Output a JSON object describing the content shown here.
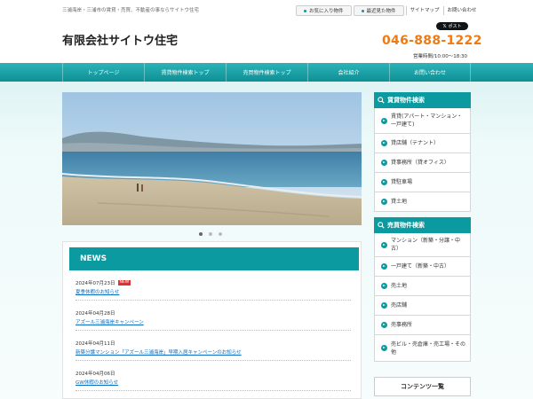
{
  "header": {
    "tagline": "三浦海岸・三浦市の賃貸・売買、不動産の事ならサイトウ住宅",
    "logo": "有限会社サイトウ住宅",
    "phone": "046-888-1222",
    "hours": "営業時間/10:00～18:30",
    "post_label": "ポスト",
    "top_links": {
      "favorites": "お気に入り物件",
      "recent": "最近見た物件",
      "sitemap": "サイトマップ",
      "contact": "お問い合わせ"
    }
  },
  "nav": {
    "items": [
      {
        "label": "トップページ"
      },
      {
        "label": "賃貸物件検索トップ"
      },
      {
        "label": "売買物件検索トップ"
      },
      {
        "label": "会社紹介"
      },
      {
        "label": "お問い合わせ"
      }
    ]
  },
  "slider": {
    "slide_count": 3,
    "active_index": 0
  },
  "news": {
    "title": "NEWS",
    "new_badge": "NEW",
    "items": [
      {
        "date": "2024年07月23日",
        "title": "夏季休暇のお知らせ",
        "is_new": true
      },
      {
        "date": "2024年04月28日",
        "title": "アズール三浦海岸キャンペーン",
        "is_new": false
      },
      {
        "date": "2024年04月11日",
        "title": "新築分譲マンション「アズール三浦海岸」早期入居キャンペーンのお知らせ",
        "is_new": false
      },
      {
        "date": "2024年04月06日",
        "title": "GW休暇のお知らせ",
        "is_new": false
      }
    ]
  },
  "sidebar": {
    "rental": {
      "title": "賃貸物件検索",
      "items": [
        {
          "label": "賃貸(アパート・マンション・一戸建て)"
        },
        {
          "label": "貸店舗（テナント）"
        },
        {
          "label": "貸事務所（貸オフィス）"
        },
        {
          "label": "貸駐車場"
        },
        {
          "label": "貸土地"
        }
      ]
    },
    "sale": {
      "title": "売買物件検索",
      "items": [
        {
          "label": "マンション（新築・分譲・中古）"
        },
        {
          "label": "一戸建て（新築・中古）"
        },
        {
          "label": "売土地"
        },
        {
          "label": "売店舗"
        },
        {
          "label": "売事務所"
        },
        {
          "label": "売ビル・売倉庫・売工場・その他"
        }
      ]
    },
    "contents_title": "コンテンツ一覧"
  },
  "colors": {
    "accent": "#0a9aa0",
    "phone": "#ee7a16",
    "new_badge": "#e03030"
  }
}
